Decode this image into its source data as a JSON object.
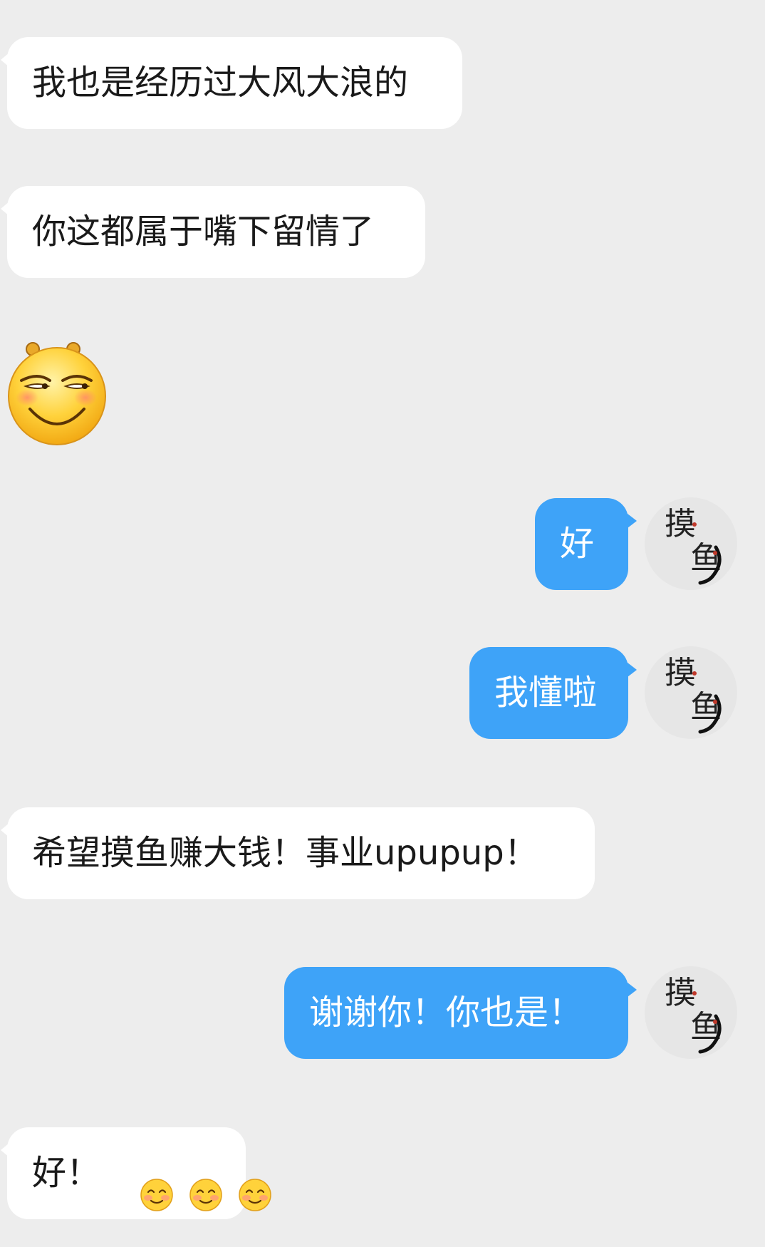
{
  "messages": [
    {
      "side": "in",
      "text": "我也是经历过大风大浪的"
    },
    {
      "side": "in",
      "text": "你这都属于嘴下留情了"
    },
    {
      "side": "in",
      "sticker": "smirk-face-sticker"
    },
    {
      "side": "out",
      "text": "好"
    },
    {
      "side": "out",
      "text": "我懂啦"
    },
    {
      "side": "in",
      "text": "希望摸鱼赚大钱！事业upupup！"
    },
    {
      "side": "out",
      "text": "谢谢你！你也是！"
    },
    {
      "side": "in",
      "text": "好！",
      "emojis": [
        "smiling-face-icon",
        "smiling-face-icon",
        "smiling-face-icon"
      ]
    }
  ],
  "avatar": {
    "text_top": "摸",
    "text_bottom": "鱼",
    "icon": "koi-fish-icon"
  },
  "colors": {
    "background": "#ededed",
    "incoming_bubble": "#ffffff",
    "outgoing_bubble": "#3ea3f8",
    "incoming_text": "#1a1a1a",
    "outgoing_text": "#ffffff"
  }
}
